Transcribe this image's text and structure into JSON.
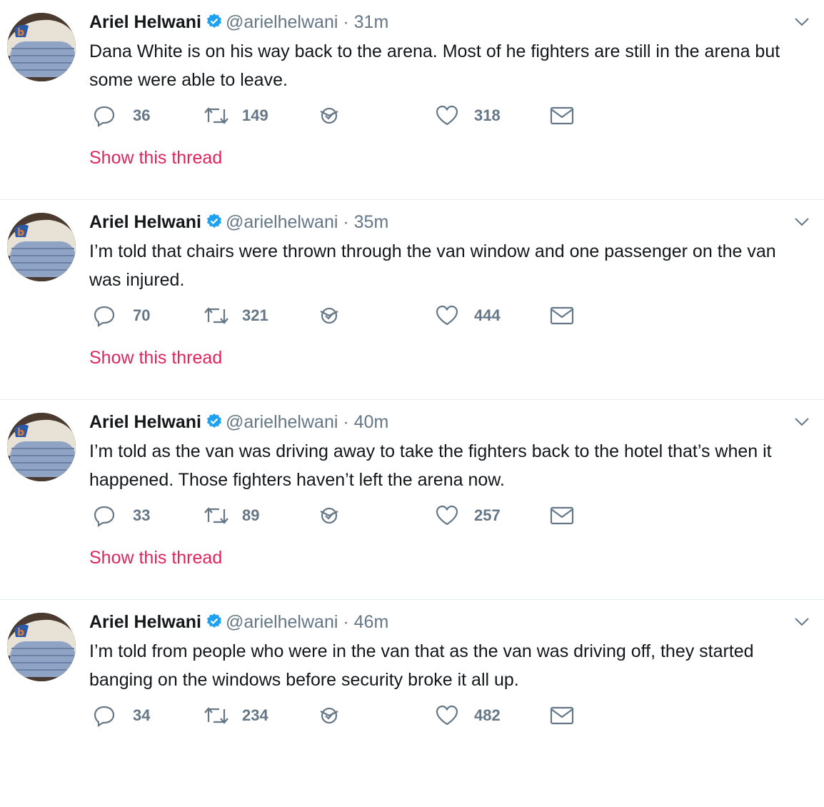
{
  "colors": {
    "text": "#14171a",
    "secondary": "#657786",
    "link": "#e0245e",
    "verified": "#1da1f2",
    "divider": "#e6ecf0"
  },
  "tweets": [
    {
      "author": "Ariel Helwani",
      "handle": "@arielhelwani",
      "separator": "·",
      "time": "31m",
      "text": "Dana White is on his way back to the arena. Most of he fighters are still in the arena but some were able to leave.",
      "replies": "36",
      "retweets": "149",
      "likes": "318",
      "thread_label": "Show this thread"
    },
    {
      "author": "Ariel Helwani",
      "handle": "@arielhelwani",
      "separator": "·",
      "time": "35m",
      "text": "I’m told that chairs were thrown through the van window and one passenger on the van was injured.",
      "replies": "70",
      "retweets": "321",
      "likes": "444",
      "thread_label": "Show this thread"
    },
    {
      "author": "Ariel Helwani",
      "handle": "@arielhelwani",
      "separator": "·",
      "time": "40m",
      "text": "I’m told as the van was driving away to take the fighters back to the hotel that’s when it happened. Those fighters haven’t left the arena now.",
      "replies": "33",
      "retweets": "89",
      "likes": "257",
      "thread_label": "Show this thread"
    },
    {
      "author": "Ariel Helwani",
      "handle": "@arielhelwani",
      "separator": "·",
      "time": "46m",
      "text": "I’m told from people who were in the van that as the van was driving off, they started banging on the windows  before security broke it all up.",
      "replies": "34",
      "retweets": "234",
      "likes": "482"
    }
  ]
}
